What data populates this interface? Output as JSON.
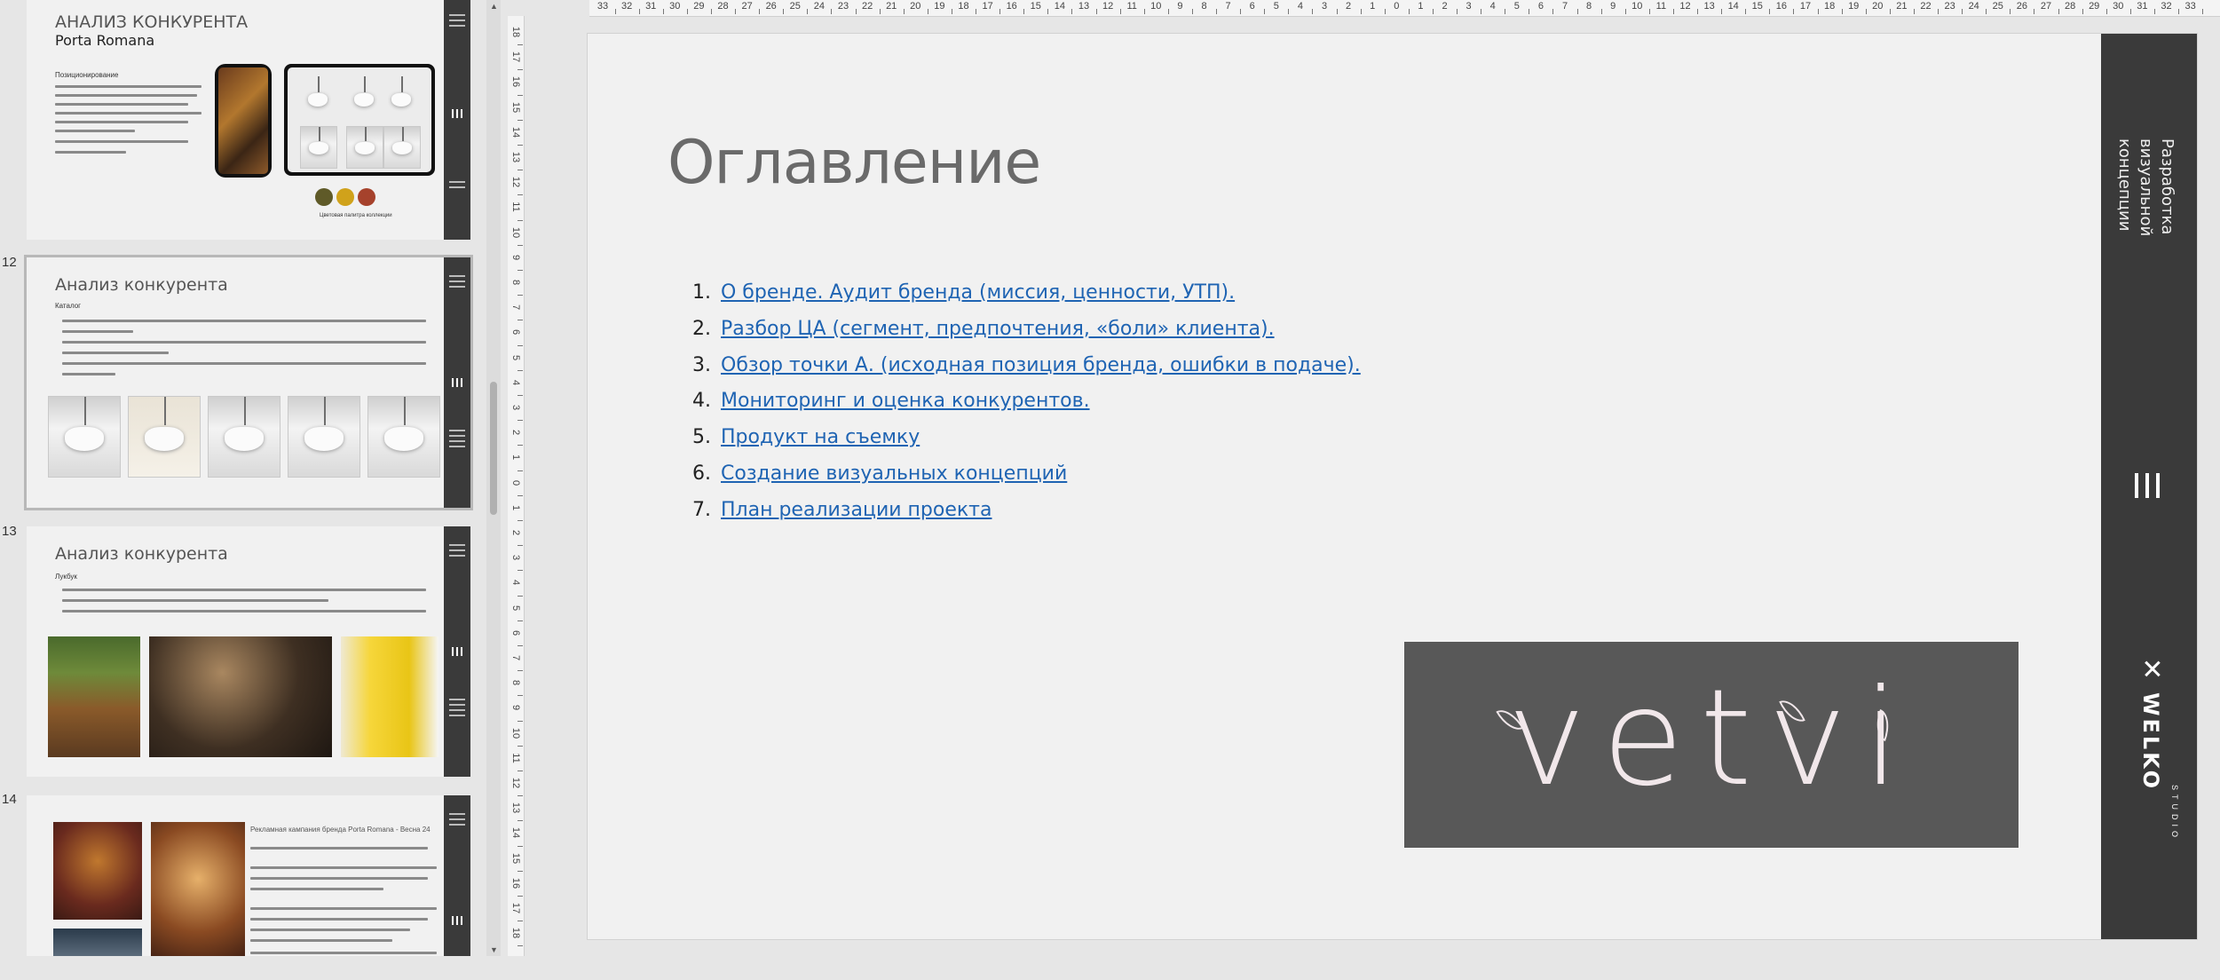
{
  "thumbnails": {
    "items": [
      {
        "number": "",
        "title": "АНАЛИЗ КОНКУРЕНТА",
        "subtitle": "Porta Romana",
        "label": "Позиционирование",
        "caption": "Цветовая палитра коллекции",
        "swatches": [
          "#5f5a28",
          "#d0a21b",
          "#a6422c"
        ]
      },
      {
        "number": "12",
        "title": "Анализ конкурента",
        "label": "Каталог"
      },
      {
        "number": "13",
        "title": "Анализ конкурента",
        "label": "Лукбук"
      },
      {
        "number": "14",
        "title": "Рекламная кампания бренда Porta Romana - Весна 24"
      }
    ]
  },
  "ruler": {
    "horizontal": [
      "33",
      "32",
      "31",
      "30",
      "29",
      "28",
      "27",
      "26",
      "25",
      "24",
      "23",
      "22",
      "21",
      "20",
      "19",
      "18",
      "17",
      "16",
      "15",
      "14",
      "13",
      "12",
      "11",
      "10",
      "9",
      "8",
      "7",
      "6",
      "5",
      "4",
      "3",
      "2",
      "1",
      "0",
      "1",
      "2",
      "3",
      "4",
      "5",
      "6",
      "7",
      "8",
      "9",
      "10",
      "11",
      "12",
      "13",
      "14",
      "15",
      "16",
      "17",
      "18",
      "19",
      "20",
      "21",
      "22",
      "23",
      "24",
      "25",
      "26",
      "27",
      "28",
      "29",
      "30",
      "31",
      "32",
      "33"
    ],
    "vertical": [
      "18",
      "17",
      "16",
      "15",
      "14",
      "13",
      "12",
      "11",
      "10",
      "9",
      "8",
      "7",
      "6",
      "5",
      "4",
      "3",
      "2",
      "1",
      "0",
      "1",
      "2",
      "3",
      "4",
      "5",
      "6",
      "7",
      "8",
      "9",
      "10",
      "11",
      "12",
      "13",
      "14",
      "15",
      "16",
      "17",
      "18"
    ]
  },
  "slide": {
    "title": "Оглавление",
    "toc": [
      {
        "num": "1.",
        "text": "О бренде. Аудит бренда (миссия, ценности, УТП)."
      },
      {
        "num": "2.",
        "text": "Разбор ЦА (сегмент, предпочтения, «боли» клиента)."
      },
      {
        "num": "3.",
        "text": "Обзор точки А. (исходная позиция бренда, ошибки в подаче)."
      },
      {
        "num": "4.",
        "text": "Мониторинг и оценка конкурентов."
      },
      {
        "num": "5.",
        "text": "Продукт на съемку"
      },
      {
        "num": "6.",
        "text": "Создание визуальных концепций"
      },
      {
        "num": "7.",
        "text": "План реализации проекта"
      }
    ],
    "logo": "vetvi",
    "side_text": "Разработка визуальной концепции",
    "brand": {
      "name": "WELKO",
      "sub": "STUDIO",
      "mark": "✕"
    }
  },
  "colors": {
    "link": "#1f64b3",
    "band": "#3a3a3a",
    "logo_box": "#585858"
  }
}
